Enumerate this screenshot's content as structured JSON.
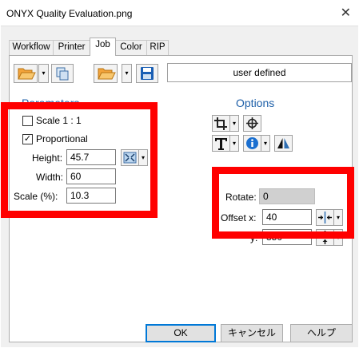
{
  "window": {
    "title": "ONYX Quality Evaluation.png",
    "close_glyph": "✕"
  },
  "tabs": [
    {
      "label": "Workflow",
      "active": false
    },
    {
      "label": "Printer",
      "active": false
    },
    {
      "label": "Job",
      "active": true
    },
    {
      "label": "Color",
      "active": false
    },
    {
      "label": "RIP",
      "active": false
    }
  ],
  "toolbar": {
    "preset_value": "user defined",
    "icons": [
      "folder-open-icon",
      "copy-icon",
      "folder-icon",
      "save-icon"
    ],
    "dropdown_glyph": "▾"
  },
  "parameters": {
    "title": "Parameters",
    "scale_1_1": {
      "label": "Scale 1 : 1",
      "checked": false
    },
    "proportional": {
      "label": "Proportional",
      "checked": true
    },
    "height": {
      "label": "Height:",
      "value": "45.7"
    },
    "width": {
      "label": "Width:",
      "value": "60"
    },
    "scale": {
      "label": "Scale (%):",
      "value": "10.3"
    }
  },
  "options": {
    "title": "Options",
    "rotate_label": "Rotate:",
    "rotate_value": "0",
    "offset_x": {
      "label": "Offset x:",
      "value": "40"
    },
    "offset_y": {
      "label": "y:",
      "value": "350"
    }
  },
  "footer": {
    "ok": "OK",
    "cancel": "キャンセル",
    "help": "ヘルプ"
  },
  "colors": {
    "accent": "#1d5fa8",
    "highlight": "#ff0000",
    "folder": "#f2a33a",
    "save": "#1a5fb4"
  }
}
